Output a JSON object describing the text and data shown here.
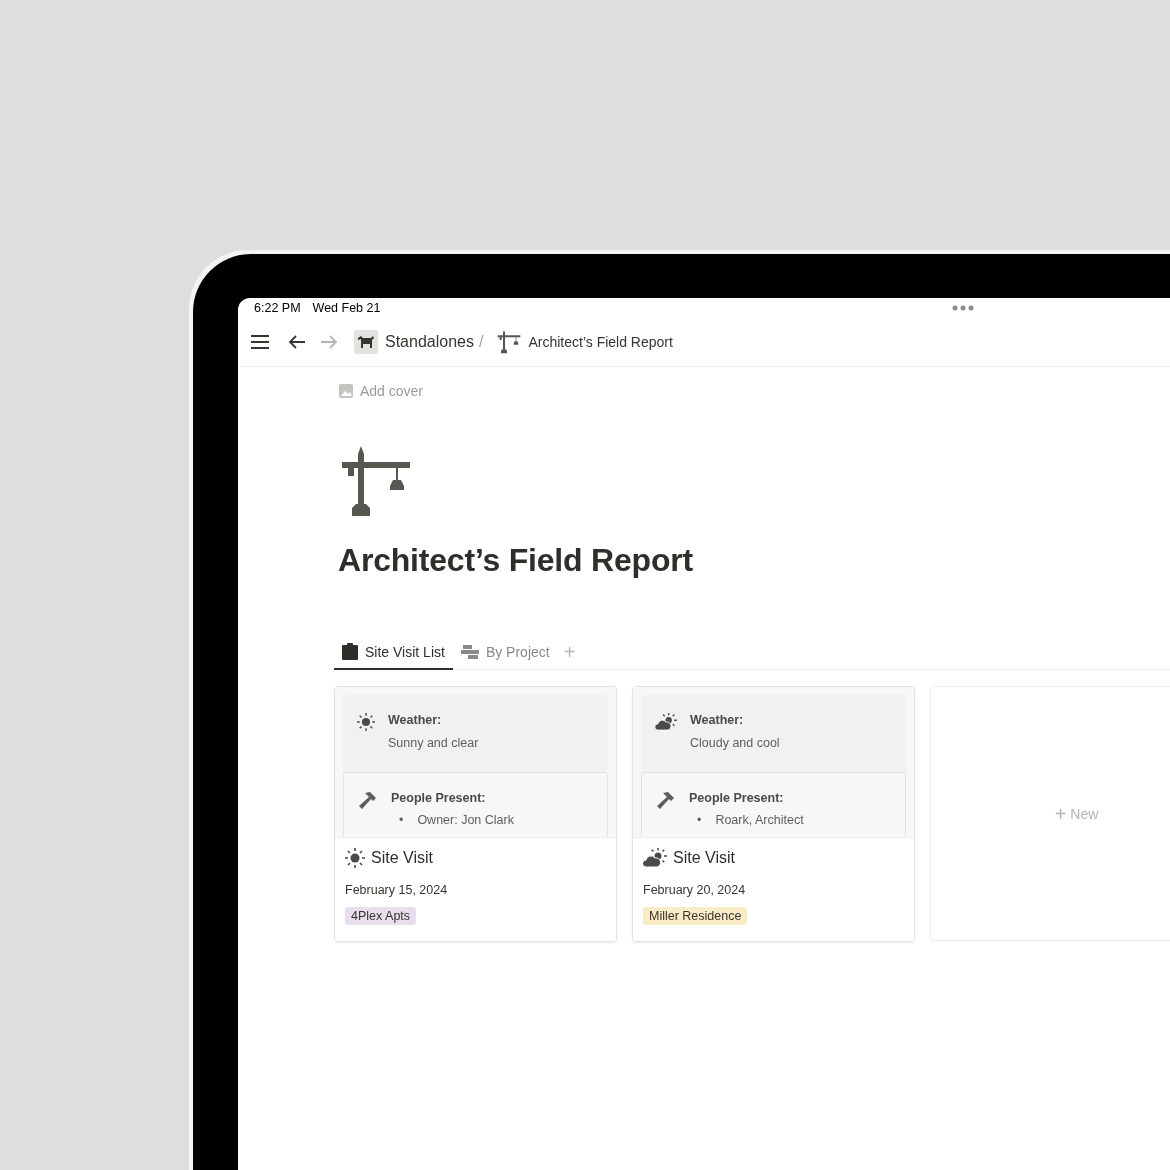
{
  "status_bar": {
    "time": "6:22 PM",
    "date": "Wed Feb 21"
  },
  "nav": {
    "back_enabled": true,
    "forward_enabled": false
  },
  "breadcrumb": [
    {
      "kind": "dog",
      "label": "Standalones",
      "separator": "/"
    },
    {
      "kind": "crane",
      "label": "Architect’s Field Report"
    }
  ],
  "page": {
    "add_cover": "Add cover",
    "title": "Architect’s Field Report"
  },
  "tabs": [
    {
      "kind": "list",
      "label": "Site Visit List",
      "selected": true
    },
    {
      "kind": "board",
      "label": "By Project",
      "selected": false
    }
  ],
  "add_tab": "+",
  "cards": [
    {
      "kind": "sunny",
      "weather_label": "Weather:",
      "weather": "Sunny and clear",
      "people_label": "People Present:",
      "people": [
        {
          "bullet": "•",
          "text": "Owner: Jon Clark"
        }
      ],
      "title": "Site Visit",
      "date": "February 15, 2024",
      "tag": {
        "label": "4Plex Apts",
        "color": "#e8deee"
      }
    },
    {
      "kind": "partly-cloudy",
      "weather_label": "Weather:",
      "weather": "Cloudy and cool",
      "people_label": "People Present:",
      "people": [
        {
          "bullet": "•",
          "text": "Roark, Architect"
        }
      ],
      "title": "Site Visit",
      "date": "February 20, 2024",
      "tag": {
        "label": "Miller Residence",
        "color": "#fbecc8"
      }
    }
  ],
  "new_card": {
    "plus": "+",
    "label": "New"
  }
}
